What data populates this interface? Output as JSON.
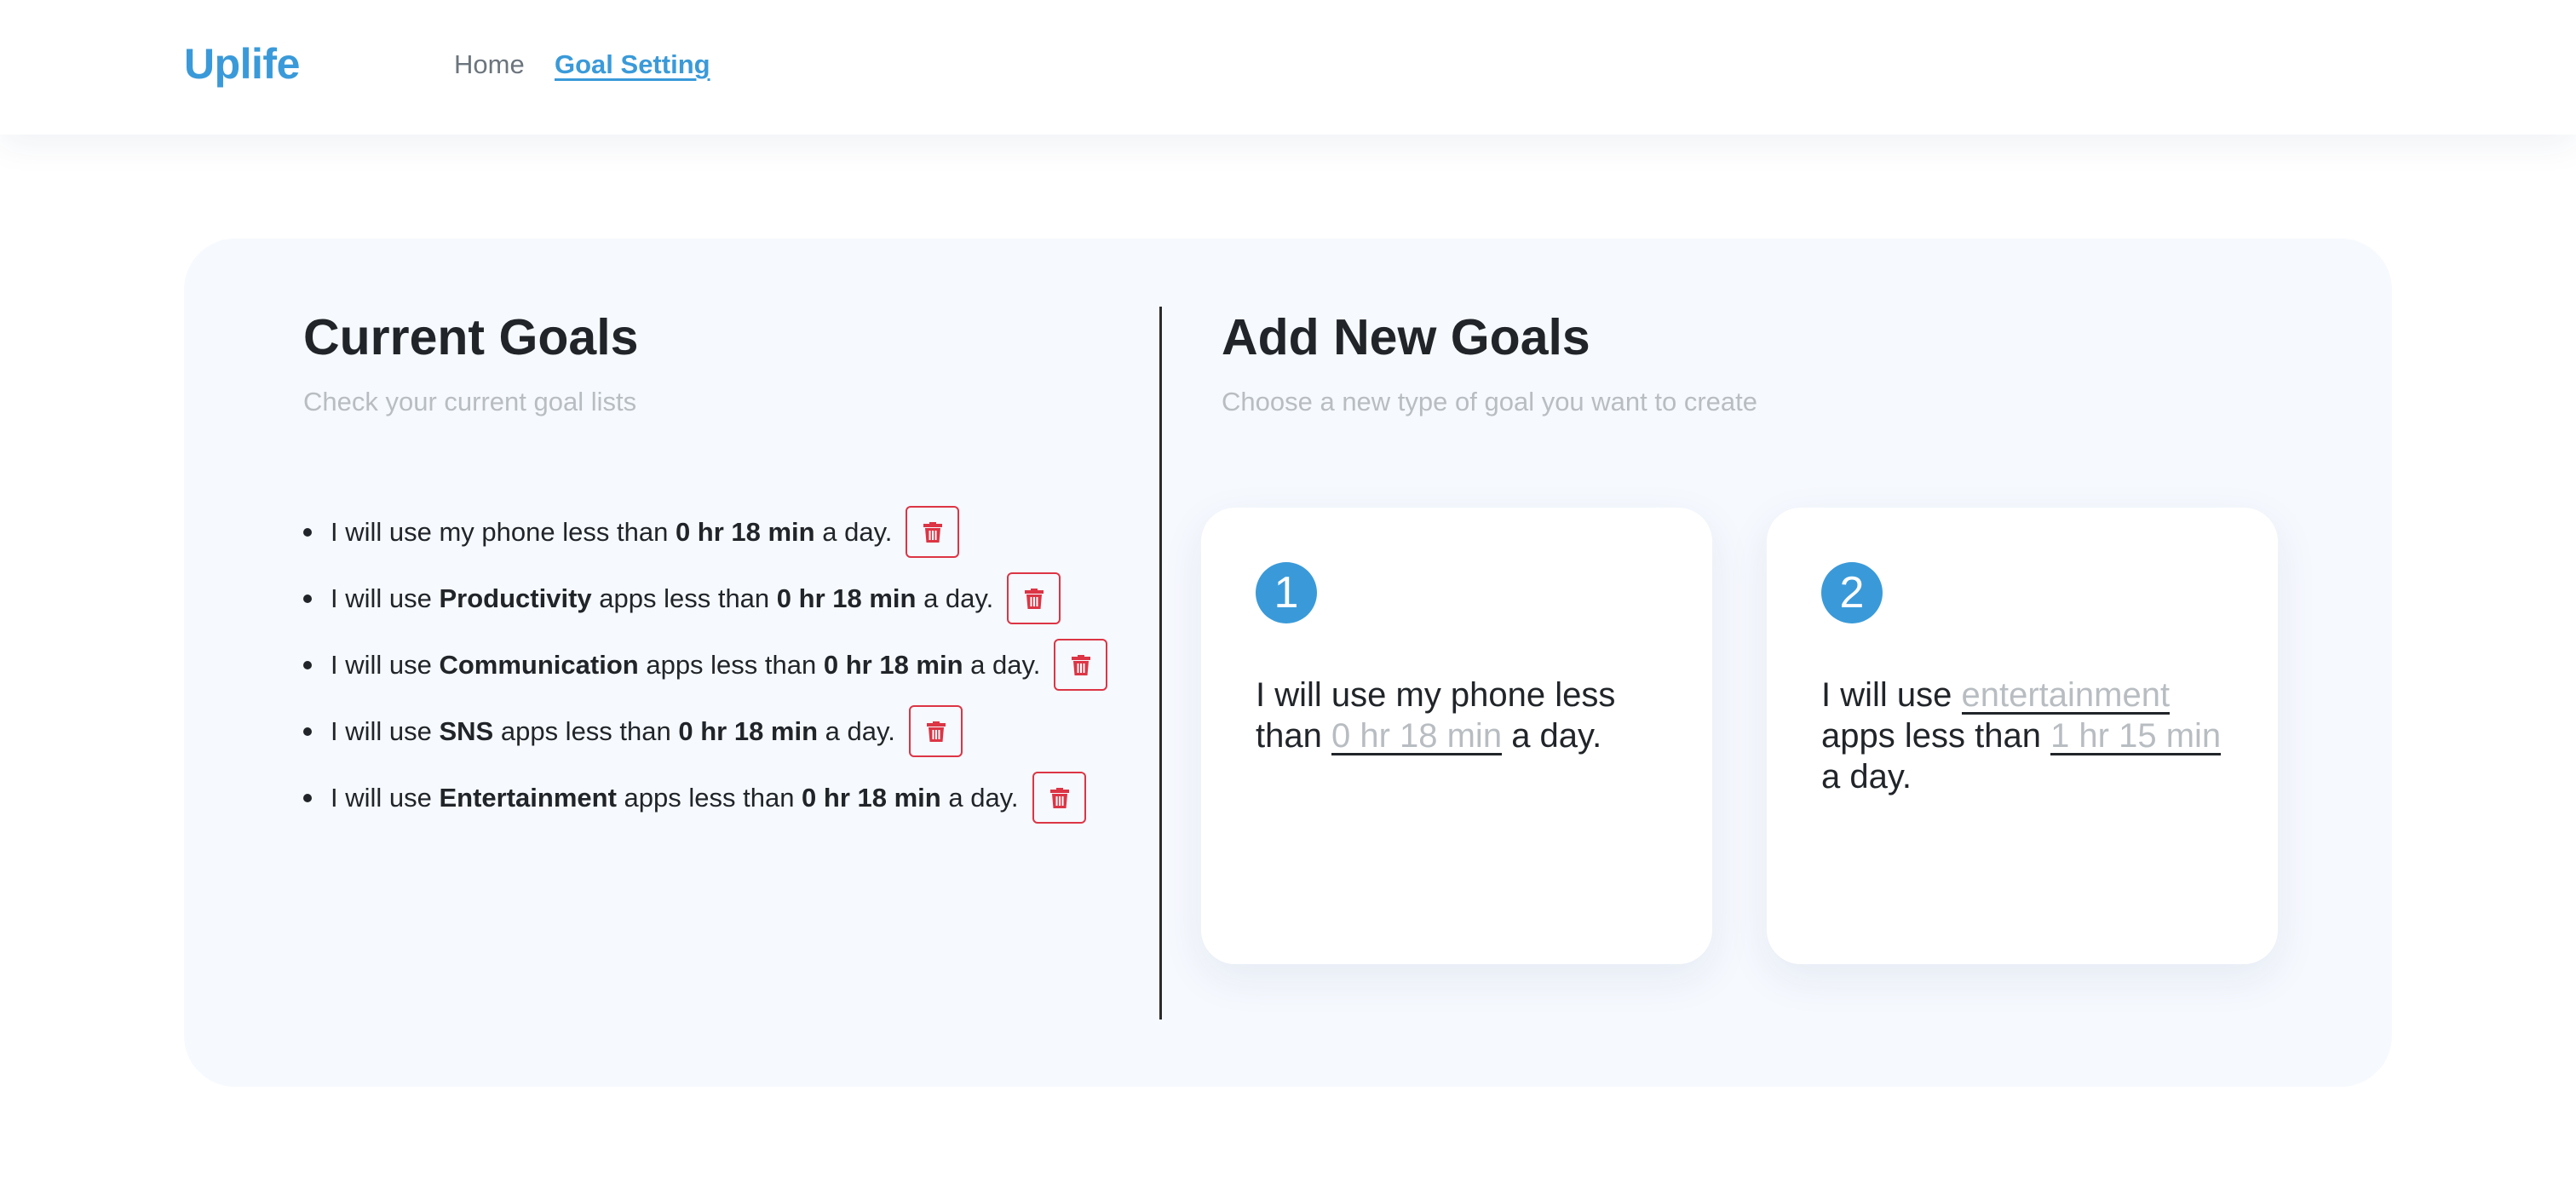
{
  "header": {
    "brand": "Uplife",
    "nav": [
      {
        "label": "Home",
        "active": false
      },
      {
        "label": "Goal Setting",
        "active": true
      }
    ]
  },
  "current_goals": {
    "title": "Current Goals",
    "subtitle": "Check your current goal lists",
    "items": [
      {
        "prefix": "I will use my phone less than ",
        "category": "",
        "mid": "",
        "time": "0 hr 18 min",
        "suffix": " a day."
      },
      {
        "prefix": "I will use ",
        "category": "Productivity",
        "mid": " apps less than ",
        "time": "0 hr 18 min",
        "suffix": " a day."
      },
      {
        "prefix": "I will use ",
        "category": "Communication",
        "mid": " apps less than ",
        "time": "0 hr 18 min",
        "suffix": " a day."
      },
      {
        "prefix": "I will use ",
        "category": "SNS",
        "mid": " apps less than ",
        "time": "0 hr 18 min",
        "suffix": " a day."
      },
      {
        "prefix": "I will use ",
        "category": "Entertainment",
        "mid": " apps less than ",
        "time": "0 hr 18 min",
        "suffix": " a day."
      }
    ],
    "delete_icon": "trash-icon"
  },
  "new_goals": {
    "title": "Add New Goals",
    "subtitle": "Choose a new type of goal you want to create",
    "cards": [
      {
        "number": "1",
        "text_a": "I will use my phone less than ",
        "time_placeholder": "0 hr 18 min",
        "text_b": " a day."
      },
      {
        "number": "2",
        "text_a": "I will use ",
        "category_placeholder": "entertainment",
        "text_b": " apps less than ",
        "time_placeholder": "1 hr 15 min",
        "text_c": " a day."
      }
    ]
  },
  "colors": {
    "accent": "#3a9ad9",
    "danger": "#dc3545",
    "panel_bg": "#f6f9fe",
    "muted_text": "#b8bdc2"
  }
}
